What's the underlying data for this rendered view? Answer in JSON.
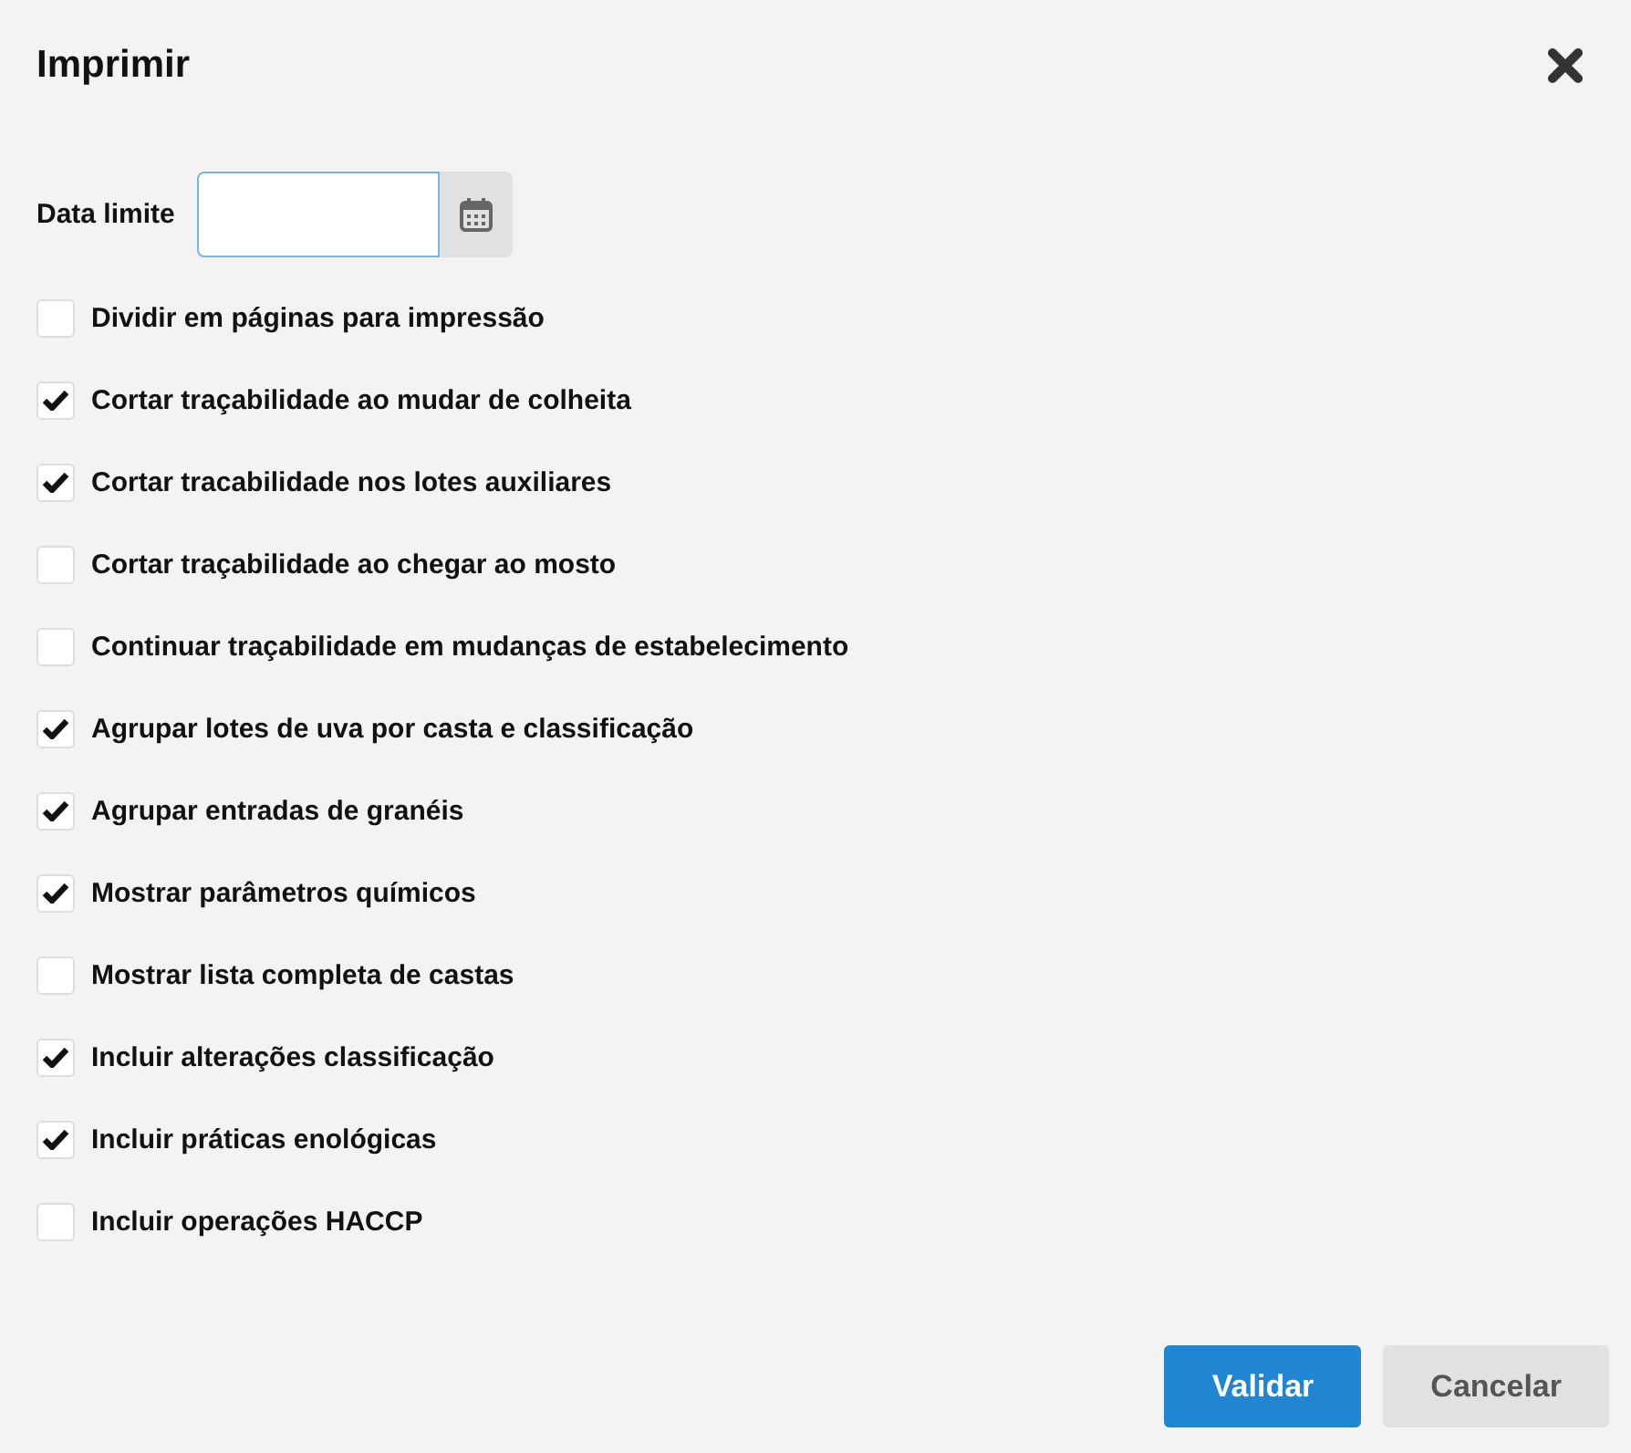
{
  "dialog": {
    "title": "Imprimir"
  },
  "date_field": {
    "label": "Data limite"
  },
  "options": [
    {
      "label": "Dividir em páginas para impressão",
      "checked": false
    },
    {
      "label": "Cortar traçabilidade ao mudar de colheita",
      "checked": true
    },
    {
      "label": "Cortar tracabilidade nos lotes auxiliares",
      "checked": true
    },
    {
      "label": "Cortar traçabilidade ao chegar ao mosto",
      "checked": false
    },
    {
      "label": "Continuar traçabilidade em mudanças de estabelecimento",
      "checked": false
    },
    {
      "label": "Agrupar lotes de uva por casta e classificação",
      "checked": true
    },
    {
      "label": "Agrupar entradas de granéis",
      "checked": true
    },
    {
      "label": "Mostrar parâmetros químicos",
      "checked": true
    },
    {
      "label": "Mostrar lista completa de castas",
      "checked": false
    },
    {
      "label": "Incluir alterações classificação",
      "checked": true
    },
    {
      "label": "Incluir práticas enológicas",
      "checked": true
    },
    {
      "label": "Incluir operações HACCP",
      "checked": false
    }
  ],
  "buttons": [
    {
      "label": "Validar",
      "kind": "primary"
    },
    {
      "label": "Cancelar",
      "kind": "secondary"
    }
  ]
}
